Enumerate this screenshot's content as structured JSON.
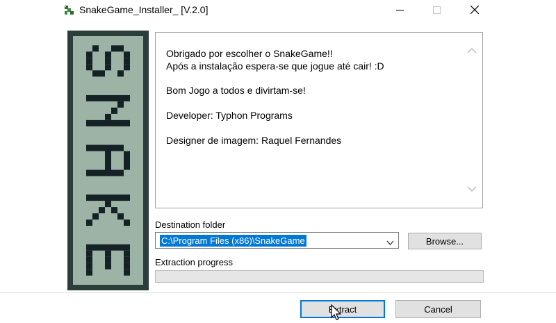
{
  "window": {
    "title": "SnakeGame_Installer_ [V.2.0]",
    "icon": "snake-app-icon",
    "controls": {
      "minimize": "minimize-icon",
      "maximize": "maximize-icon",
      "close": "close-icon"
    }
  },
  "banner": {
    "text": "SNAKE",
    "colors": {
      "frame": "#2b3e3c",
      "background": "#9cb3a6",
      "letters": "#152225"
    }
  },
  "message": {
    "lines": [
      "Obrigado por escolher o SnakeGame!!",
      "Após a instalação espera-se que jogue até cair! :D",
      "Bom Jogo a todos e divirtam-se!",
      "Developer: Typhon Programs",
      "Designer de imagem: Raquel Fernandes"
    ]
  },
  "destination": {
    "label": "Destination folder",
    "value": "C:\\Program Files (x86)\\SnakeGame",
    "browse_label": "Browse..."
  },
  "progress": {
    "label": "Extraction progress",
    "value": 0
  },
  "buttons": {
    "extract_label": "Extract",
    "cancel_label": "Cancel"
  },
  "colors": {
    "accent": "#0078d7",
    "button_face": "#e1e1e1",
    "progress_fill": "#06b025"
  }
}
